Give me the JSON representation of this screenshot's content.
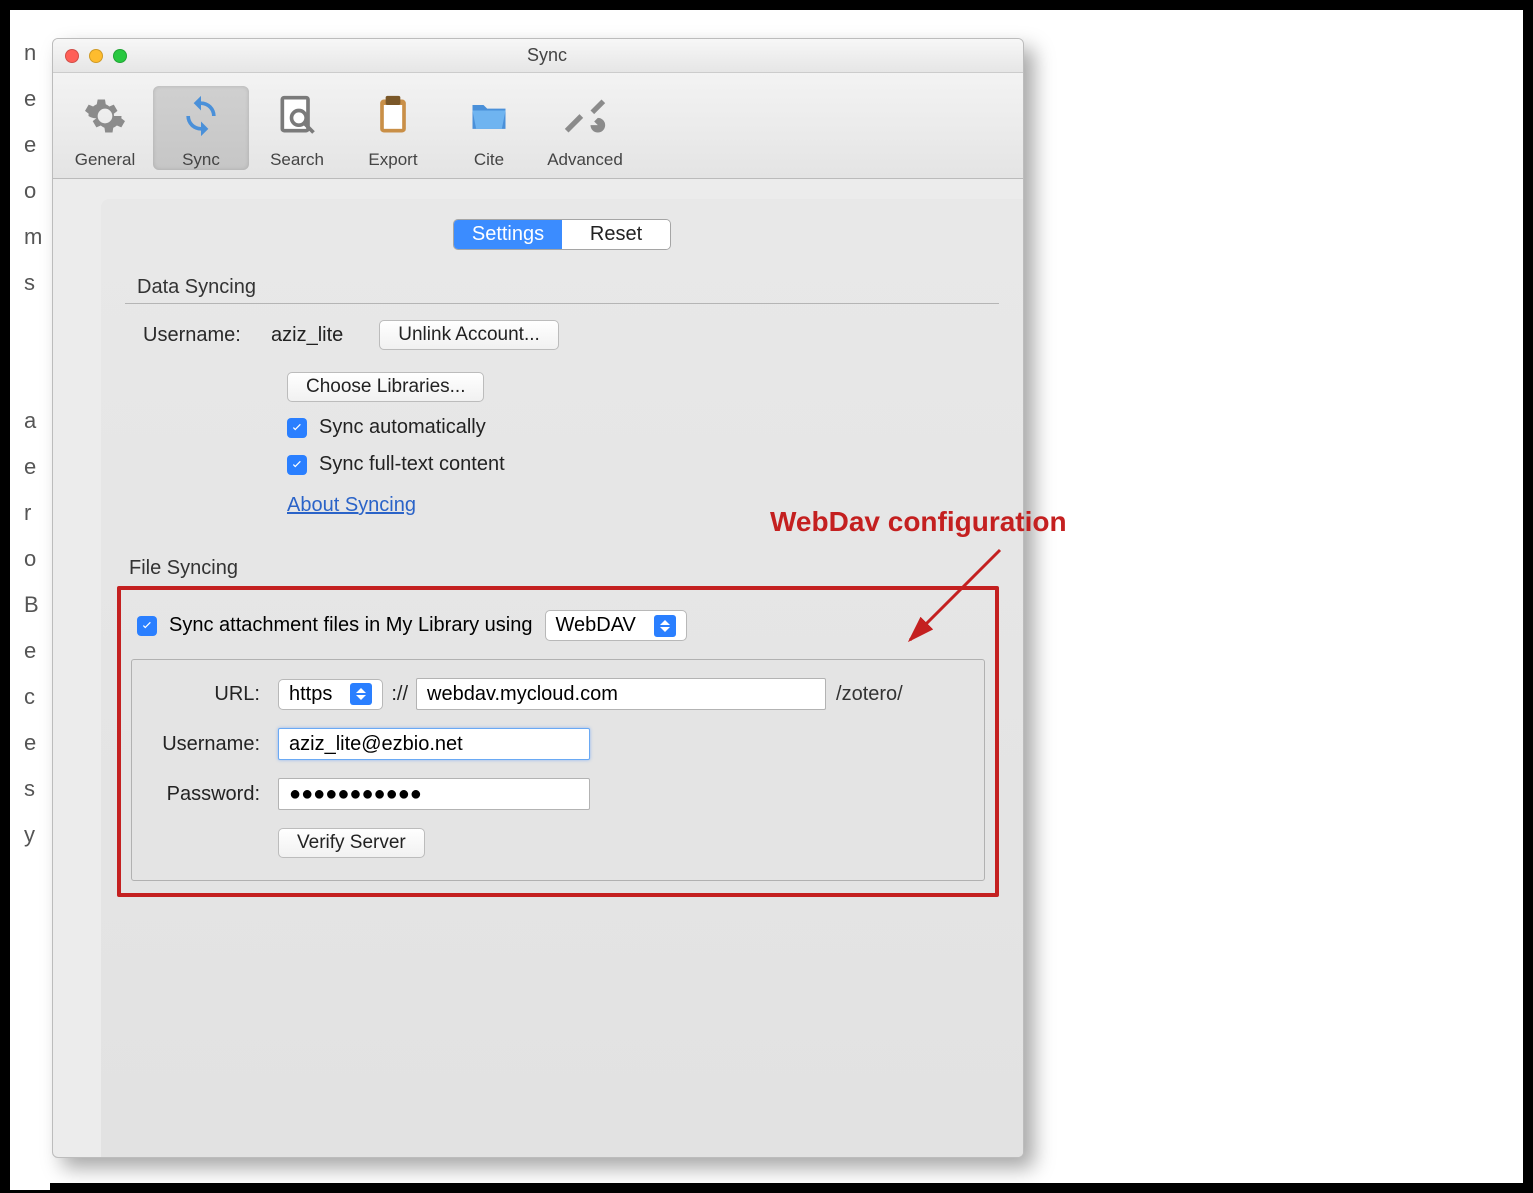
{
  "window": {
    "title": "Sync"
  },
  "toolbar": {
    "items": [
      {
        "label": "General"
      },
      {
        "label": "Sync"
      },
      {
        "label": "Search"
      },
      {
        "label": "Export"
      },
      {
        "label": "Cite"
      },
      {
        "label": "Advanced"
      }
    ]
  },
  "tabs": {
    "settings": "Settings",
    "reset": "Reset"
  },
  "data_syncing": {
    "heading": "Data Syncing",
    "username_label": "Username:",
    "username_value": "aziz_lite",
    "unlink_btn": "Unlink Account...",
    "choose_libs": "Choose Libraries...",
    "sync_auto": "Sync automatically",
    "sync_fulltext": "Sync full-text content",
    "about_link": "About Syncing"
  },
  "file_syncing": {
    "heading": "File Syncing",
    "attach_label": "Sync attachment files in My Library using",
    "method": "WebDAV",
    "url_label": "URL:",
    "protocol": "https",
    "proto_sep": "://",
    "url_value": "webdav.mycloud.com",
    "url_suffix": "/zotero/",
    "user_label": "Username:",
    "user_value": "aziz_lite@ezbio.net",
    "pass_label": "Password:",
    "pass_value": "●●●●●●●●●●●",
    "verify_btn": "Verify Server"
  },
  "annotation": {
    "label": "WebDav configuration"
  }
}
